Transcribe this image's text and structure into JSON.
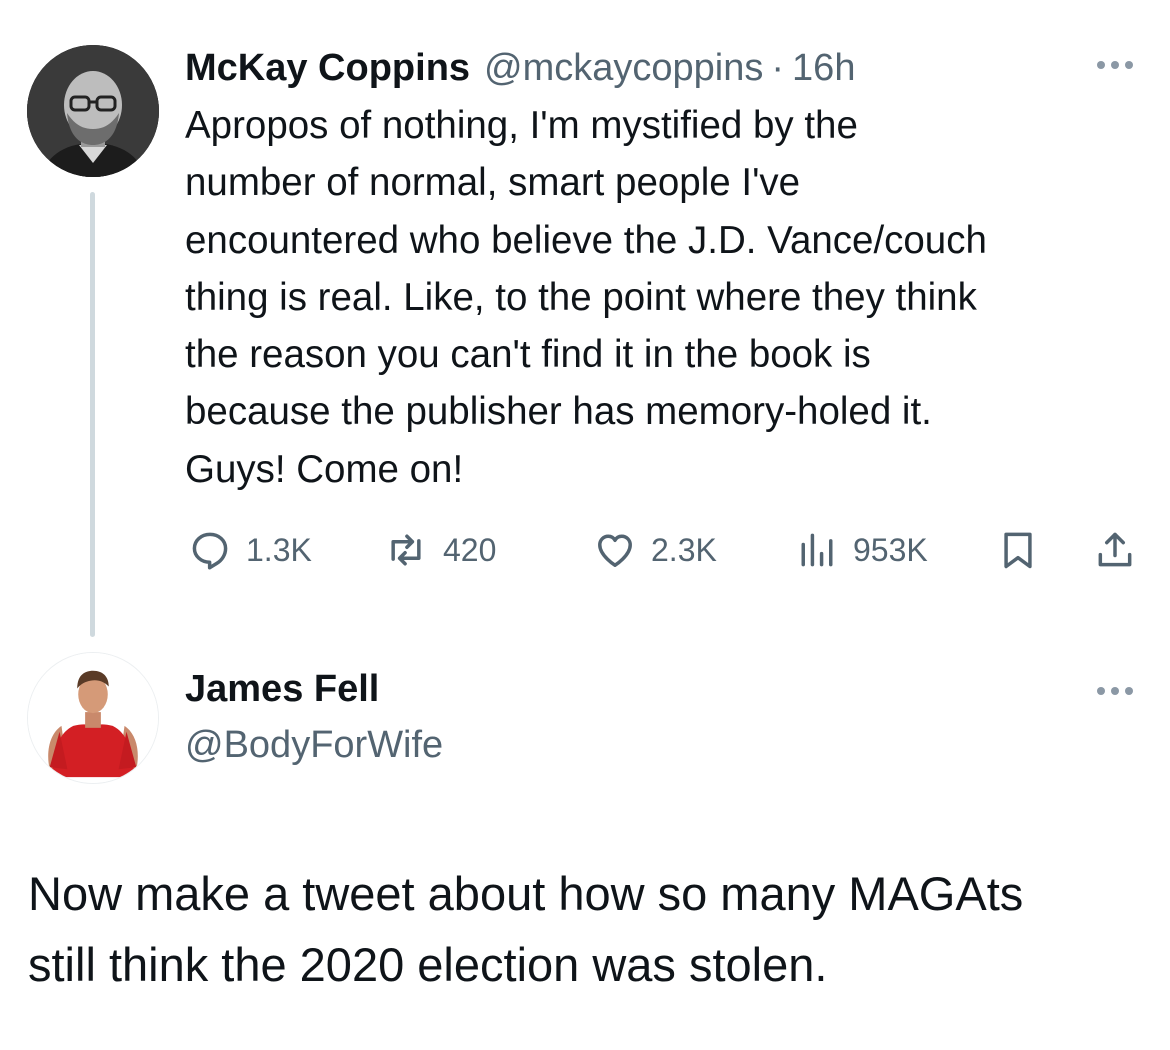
{
  "tweet": {
    "author": {
      "display_name": "McKay Coppins",
      "handle": "@mckaycoppins",
      "separator": "·",
      "time": "16h",
      "avatar_icon": "profile-photo-man-glasses"
    },
    "text_lines": [
      "Apropos of nothing, I'm mystified by the",
      "number of normal, smart people I've",
      "encountered who believe the J.D. Vance/couch",
      "thing is real. Like, to the point where they think",
      "the reason you can't find it in the book is",
      "because the publisher has memory-holed it.",
      "Guys! Come on!"
    ],
    "actions": {
      "replies": "1.3K",
      "reposts": "420",
      "likes": "2.3K",
      "views": "953K"
    }
  },
  "reply": {
    "author": {
      "display_name": "James Fell",
      "handle": "@BodyForWife",
      "avatar_icon": "profile-photo-man-red-shirt"
    },
    "text_lines": [
      "Now make a tweet about how so many MAGAts",
      "still think the 2020 election was stolen."
    ]
  },
  "colors": {
    "text": "#0f1419",
    "secondary": "#536471",
    "thread_line": "#cfd9de",
    "background": "#ffffff"
  }
}
